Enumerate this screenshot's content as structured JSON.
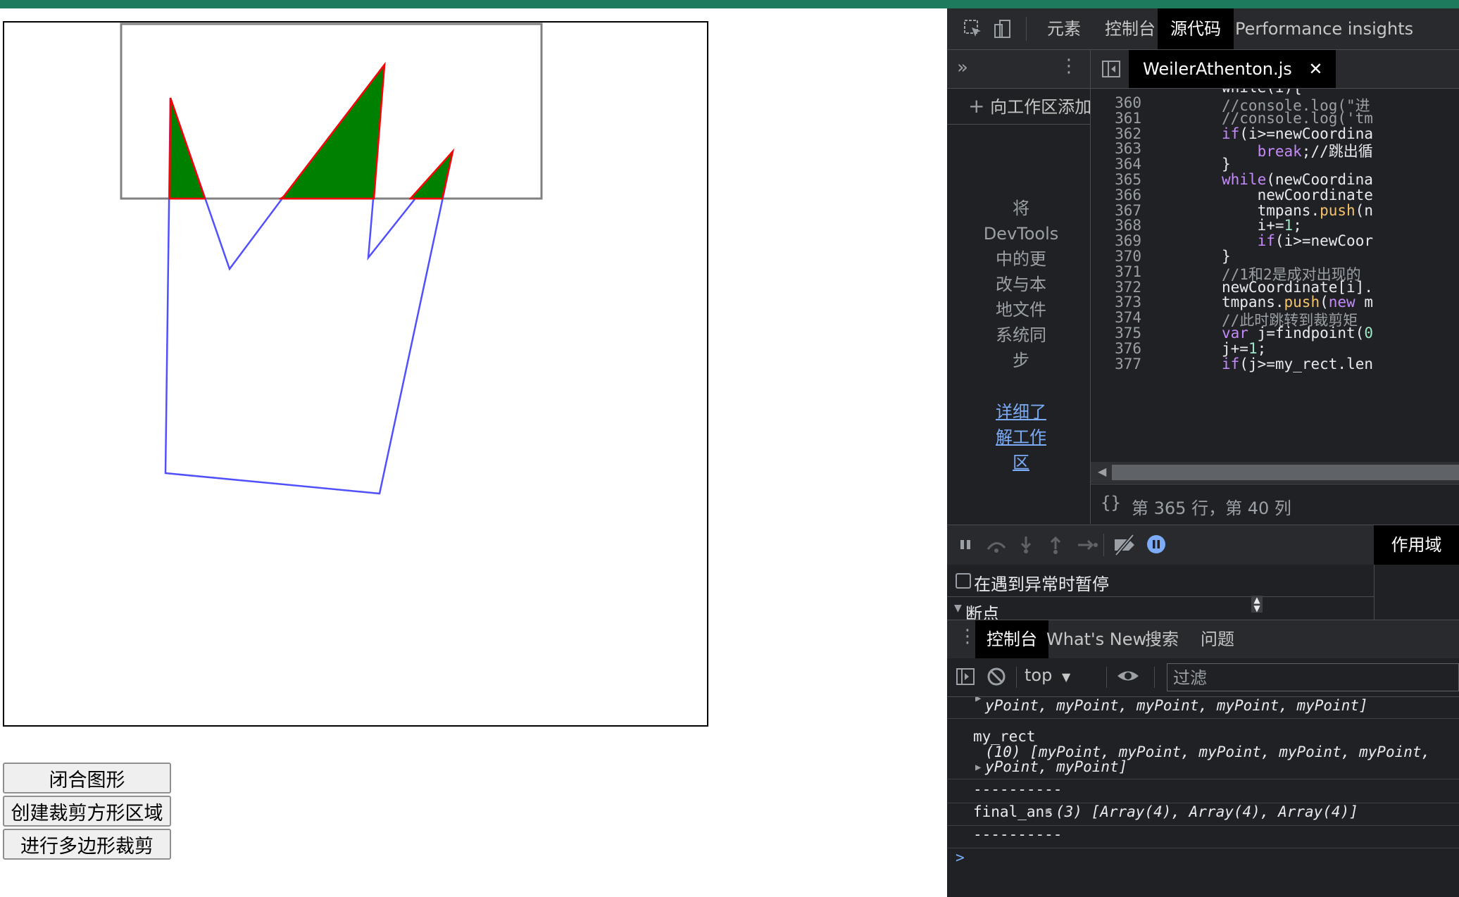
{
  "page": {
    "buttons": [
      "闭合图形",
      "创建裁剪方形区域",
      "进行多边形裁剪"
    ]
  },
  "devtools": {
    "tabs": [
      "元素",
      "控制台",
      "源代码",
      "Performance insights"
    ],
    "active_tab": "源代码",
    "navigator": {
      "add_workspace": "向工作区添加",
      "message_lines": [
        "将",
        "DevTools",
        "中的更",
        "改与本",
        "地文件",
        "系统同",
        "步"
      ],
      "link_lines": [
        "详细了",
        "解工作",
        "区"
      ]
    },
    "editor": {
      "file_name": "WeilerAthenton.js",
      "top_partial": "while(i){",
      "line_numbers": [
        "360",
        "361",
        "362",
        "363",
        "364",
        "365",
        "366",
        "367",
        "368",
        "369",
        "370",
        "371",
        "372",
        "373",
        "374",
        "375",
        "376",
        "377"
      ],
      "lines": [
        "//console.log(\"进",
        "//console.log('tm",
        "if(i>=newCoordina",
        "    break;//跳出循",
        "}",
        "while(newCoordina",
        "    newCoordinate",
        "    tmpans.push(n",
        "    i+=1;",
        "    if(i>=newCoor",
        "}",
        "//1和2是成对出现的",
        "newCoordinate[i].",
        "tmpans.push(new m",
        "//此时跳转到裁剪矩",
        "var j=findpoint(0",
        "j+=1;",
        "if(j>=my_rect.len"
      ],
      "status": "第 365 行，第 40 列",
      "format_icon": "{}"
    },
    "debugger": {
      "scope_tab": "作用域",
      "pause_on_exceptions": "在遇到异常时暂停",
      "breakpoints": "断点"
    },
    "console": {
      "tabs": [
        "控制台",
        "What's New",
        "搜索",
        "问题"
      ],
      "active_tab": "控制台",
      "context": "top",
      "filter_placeholder": "过滤",
      "lines": {
        "l1": "yPoint, myPoint, myPoint, myPoint, myPoint]",
        "l2": "my_rect",
        "l3": "(10) [myPoint, myPoint, myPoint, myPoint, myPoint,",
        "l4": "yPoint, myPoint]",
        "l5": "----------",
        "l6_label": "final_ans",
        "l6_value": "(3) [Array(4), Array(4), Array(4)]",
        "l7": "----------",
        "prompt": ">"
      }
    }
  },
  "colors": {
    "topbar": "#1d7a5c",
    "fill": "#008000",
    "clip_edge": "#ff0000",
    "polygon": "#5050ff",
    "rect": "#808080"
  }
}
